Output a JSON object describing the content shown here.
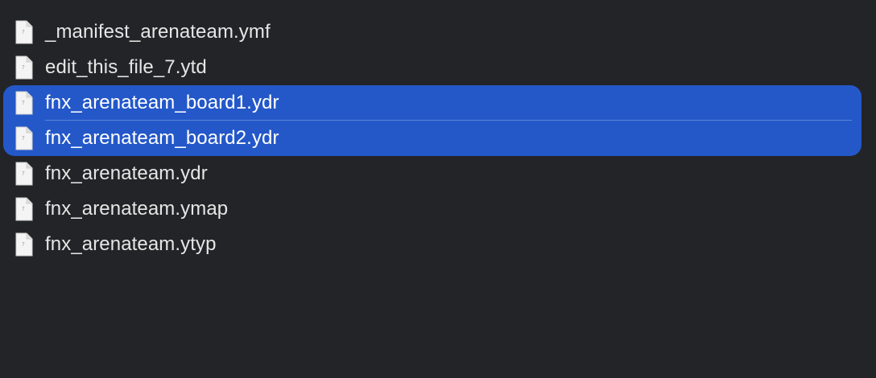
{
  "files": [
    {
      "name": "_manifest_arenateam.ymf",
      "selected": false,
      "icon": "generic-document-icon"
    },
    {
      "name": "edit_this_file_7.ytd",
      "selected": false,
      "icon": "generic-document-icon"
    },
    {
      "name": "fnx_arenateam_board1.ydr",
      "selected": true,
      "icon": "generic-document-icon"
    },
    {
      "name": "fnx_arenateam_board2.ydr",
      "selected": true,
      "icon": "generic-document-icon"
    },
    {
      "name": "fnx_arenateam.ydr",
      "selected": false,
      "icon": "generic-document-icon"
    },
    {
      "name": "fnx_arenateam.ymap",
      "selected": false,
      "icon": "generic-document-icon"
    },
    {
      "name": "fnx_arenateam.ytyp",
      "selected": false,
      "icon": "generic-document-icon"
    }
  ],
  "colors": {
    "background": "#232427",
    "selection": "#2458c9",
    "text": "#e6e6e6",
    "selected_text": "#ffffff"
  }
}
